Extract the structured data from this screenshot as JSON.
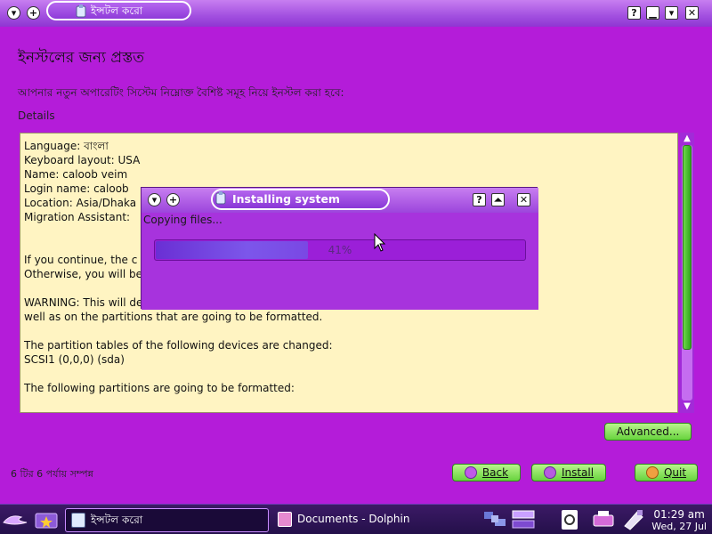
{
  "window": {
    "title": "ইন্সটল করো",
    "icons": [
      "shade-down-icon",
      "keep-above-icon",
      "help-icon",
      "minimize-icon",
      "maximize-icon",
      "close-icon"
    ]
  },
  "page": {
    "title": "ইনস্টলের জন্য প্রস্তত",
    "subtitle": "আপনার নতুন অপারেটিং সিস্টেম নিম্নোক্ত বৈশিষ্ট সমূহ নিয়ে ইনস্টল করা হবে:",
    "details_label": "Details",
    "details_lines": [
      "Language: বাংলা",
      "Keyboard layout: USA",
      "Name: caloob veim",
      "Login name: caloob",
      "Location: Asia/Dhaka",
      "Migration Assistant:",
      "",
      "",
      "If you continue, the c",
      "Otherwise, you will be",
      "",
      "WARNING: This will destroy all data on any partitions you have removed as",
      "well as on the partitions that are going to be formatted.",
      "",
      "The partition tables of the following devices are changed:",
      "SCSI1 (0,0,0) (sda)",
      "",
      "The following partitions are going to be formatted:"
    ],
    "advanced_label": "Advanced...",
    "steps_text": "6 টির 6 পর্যায় সম্পন্ন",
    "back_label": "Back",
    "install_label": "Install",
    "quit_label": "Quit"
  },
  "dialog": {
    "title": "Installing system",
    "status": "Copying files...",
    "progress": 0.41,
    "progress_label": "41%"
  },
  "taskbar": {
    "tasks": [
      {
        "label": "ইন্সটল করো",
        "active": true
      },
      {
        "label": "Documents - Dolphin",
        "active": false
      }
    ],
    "clock_time": "01:29 am",
    "clock_date": "Wed, 27 Jul"
  },
  "colors": {
    "background": "#b41cd9",
    "details_bg": "#fff4c2",
    "button_green": "#68d33e",
    "taskbar": "#2a1250"
  }
}
